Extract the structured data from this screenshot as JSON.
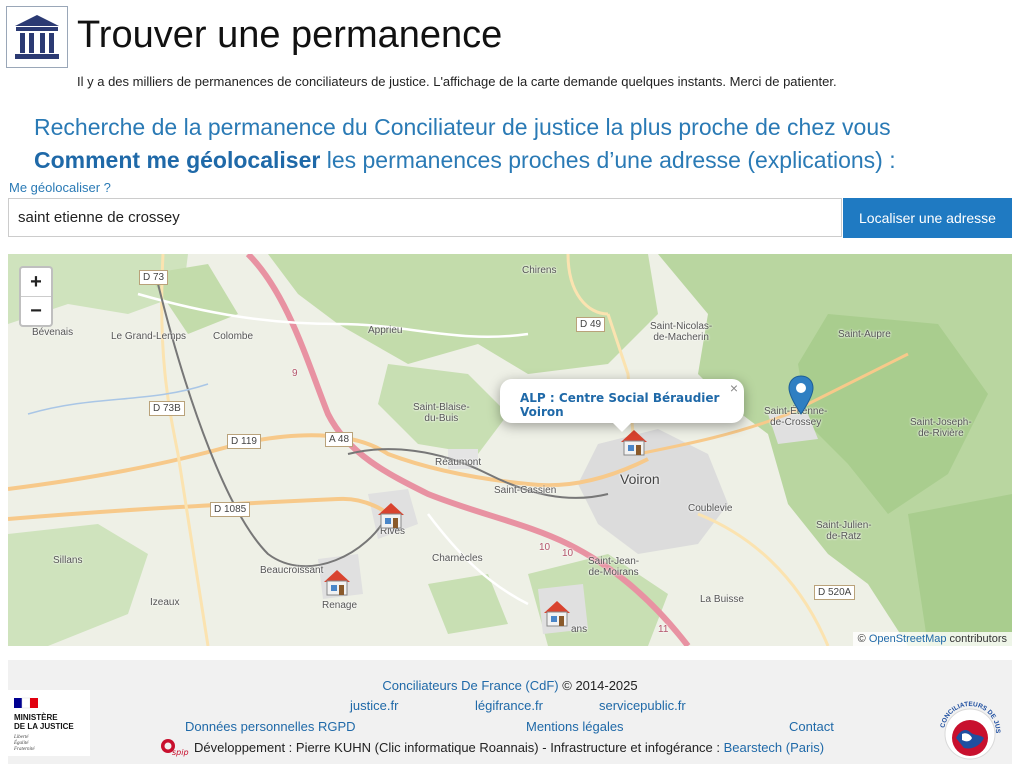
{
  "header": {
    "logo_icon": "courthouse-columns-icon",
    "title": "Trouver une permanence",
    "notice": "Il y a des milliers de permanences de conciliateurs de justice. L'affichage de la carte demande quelques instants. Merci de patienter."
  },
  "intro": {
    "line1": "Recherche de la permanence du Conciliateur de justice la plus proche de chez vous",
    "line2_bold": "Comment me géolocaliser",
    "line2_rest": " les permanences proches d’une adresse (explications) :"
  },
  "search": {
    "geolocate_link": "Me géolocaliser ?",
    "value": "saint etienne de crossey",
    "button_label": "Localiser une adresse"
  },
  "map": {
    "zoom_in": "+",
    "zoom_out": "−",
    "popup_title": "ALP : Centre Social Béraudier Voiron",
    "popup_close": "×",
    "attribution_link": "OpenStreetMap",
    "attribution_rest": " contributors",
    "attribution_symbol": "©",
    "places": {
      "chirens": "Chirens",
      "bevenais": "Bévenais",
      "le_grand_lemps": "Le Grand-Lemps",
      "colombe": "Colombe",
      "apprieu": "Apprieu",
      "saint_nicolas": "Saint-Nicolas-\nde-Macherin",
      "saint_aupre": "Saint-Aupre",
      "saint_blaise": "Saint-Blaise-\ndu-Buis",
      "saint_etienne": "Saint-Étienne-\nde-Crossey",
      "saint_joseph": "Saint-Joseph-\nde-Rivière",
      "reaumont": "Réaumont",
      "saint_cassien": "Saint-Cassien",
      "voiron": "Voiron",
      "coublevie": "Coublevie",
      "rives": "Rives",
      "saint_julien": "Saint-Julien-\nde-Ratz",
      "sillans": "Sillans",
      "charnecles": "Charnècles",
      "saint_jean_moirans": "Saint-Jean-\nde-Moirans",
      "beaucroissant": "Beaucroissant",
      "renage": "Renage",
      "izeaux": "Izeaux",
      "la_buisse": "La Buisse",
      "moirans_partial": "ans"
    },
    "roads": {
      "d73": "D 73",
      "d49": "D 49",
      "d73b": "D 73B",
      "d119": "D 119",
      "a48": "A 48",
      "d1085": "D 1085",
      "d520a": "D 520A",
      "exit9": "9",
      "exit10a": "10",
      "exit10b": "10",
      "exit11": "11"
    },
    "house_icon": "house-marker-icon",
    "location_icon": "map-pin-icon",
    "colors": {
      "forest": "#bcd8a8",
      "farmland": "#eef0e6",
      "urban": "#dcdcdc",
      "motorway": "#e892a2",
      "primary_road": "#f7c98a",
      "accent": "#1f7ac2",
      "link": "#1f69a8"
    }
  },
  "footer": {
    "cdf_link": "Conciliateurs De France (CdF)",
    "cdf_rest": " © 2014-2025",
    "links_row1": [
      "justice.fr",
      "légifrance.fr",
      "servicepublic.fr"
    ],
    "links_row2": [
      "Données personnelles RGPD",
      "Mentions légales",
      "Contact"
    ],
    "dev_text": "Développement : Pierre KUHN (Clic informatique Roannais) - Infrastructure et infogérance : ",
    "dev_link": "Bearstech (Paris)",
    "spip_logo": "spip",
    "ministere_lines": [
      "MINISTÈRE",
      "DE LA JUSTICE"
    ],
    "ministere_motto": [
      "Liberté",
      "Égalité",
      "Fraternité"
    ],
    "cdf_logo_text": "CONCILIATEURS DE JUSTICE"
  }
}
